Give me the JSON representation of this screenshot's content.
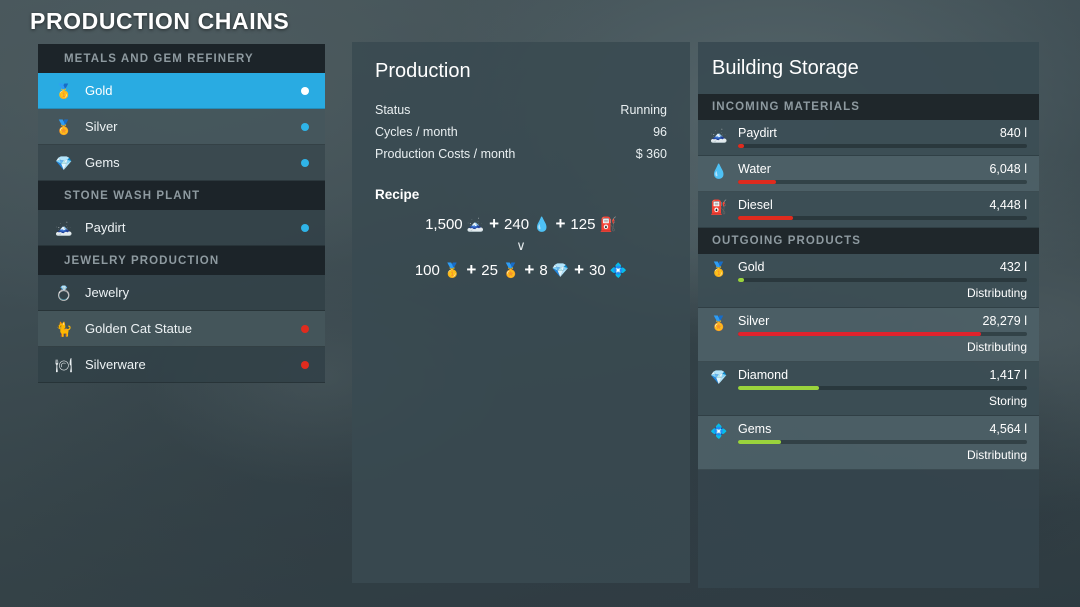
{
  "page": {
    "title": "PRODUCTION CHAINS"
  },
  "sidebar": {
    "groups": [
      {
        "header": "METALS AND GEM REFINERY",
        "items": [
          {
            "label": "Gold",
            "icon": "gold-bars-icon",
            "glyph": "🥇",
            "status": "white",
            "selected": true,
            "shade": "sel"
          },
          {
            "label": "Silver",
            "icon": "silver-bars-icon",
            "glyph": "🏅",
            "status": "cyan",
            "selected": false,
            "shade": "light"
          },
          {
            "label": "Gems",
            "icon": "gems-icon",
            "glyph": "💎",
            "status": "cyan",
            "selected": false,
            "shade": "alt"
          }
        ]
      },
      {
        "header": "STONE WASH PLANT",
        "items": [
          {
            "label": "Paydirt",
            "icon": "paydirt-pile-icon",
            "glyph": "🗻",
            "status": "cyan",
            "selected": false,
            "shade": "base"
          }
        ]
      },
      {
        "header": "JEWELRY PRODUCTION",
        "items": [
          {
            "label": "Jewelry",
            "icon": "ring-icon",
            "glyph": "💍",
            "status": "none",
            "selected": false,
            "shade": "base"
          },
          {
            "label": "Golden Cat Statue",
            "icon": "golden-cat-icon",
            "glyph": "🐈",
            "status": "red",
            "selected": false,
            "shade": "light"
          },
          {
            "label": "Silverware",
            "icon": "silverware-icon",
            "glyph": "🍽",
            "status": "red",
            "selected": false,
            "shade": "base"
          }
        ]
      }
    ]
  },
  "production": {
    "title": "Production",
    "stats": [
      {
        "label": "Status",
        "value": "Running"
      },
      {
        "label": "Cycles / month",
        "value": "96"
      },
      {
        "label": "Production Costs / month",
        "value": "$ 360"
      }
    ],
    "recipe_title": "Recipe",
    "recipe_arrow": "∨",
    "inputs": [
      {
        "amount": "1,500",
        "name": "paydirt",
        "glyph": "🗻"
      },
      {
        "amount": "240",
        "name": "water",
        "glyph": "💧"
      },
      {
        "amount": "125",
        "name": "diesel",
        "glyph": "⛽"
      }
    ],
    "outputs": [
      {
        "amount": "100",
        "name": "gold",
        "glyph": "🥇"
      },
      {
        "amount": "25",
        "name": "silver",
        "glyph": "🏅"
      },
      {
        "amount": "8",
        "name": "diamond",
        "glyph": "💎"
      },
      {
        "amount": "30",
        "name": "gems",
        "glyph": "💠"
      }
    ],
    "plus": "+"
  },
  "storage": {
    "title": "Building Storage",
    "incoming_header": "INCOMING MATERIALS",
    "outgoing_header": "OUTGOING PRODUCTS",
    "incoming": [
      {
        "name": "Paydirt",
        "glyph": "🗻",
        "amount": "840 l",
        "fill": 2,
        "color": "#e02b1e",
        "state": ""
      },
      {
        "name": "Water",
        "glyph": "💧",
        "amount": "6,048 l",
        "fill": 13,
        "color": "#e02b1e",
        "state": ""
      },
      {
        "name": "Diesel",
        "glyph": "⛽",
        "amount": "4,448 l",
        "fill": 19,
        "color": "#e02b1e",
        "state": ""
      }
    ],
    "outgoing": [
      {
        "name": "Gold",
        "glyph": "🥇",
        "amount": "432 l",
        "fill": 2,
        "color": "#9ad33c",
        "state": "Distributing"
      },
      {
        "name": "Silver",
        "glyph": "🏅",
        "amount": "28,279 l",
        "fill": 84,
        "color": "#e0232c",
        "state": "Distributing"
      },
      {
        "name": "Diamond",
        "glyph": "💎",
        "amount": "1,417 l",
        "fill": 28,
        "color": "#9ad33c",
        "state": "Storing"
      },
      {
        "name": "Gems",
        "glyph": "💠",
        "amount": "4,564 l",
        "fill": 15,
        "color": "#9ad33c",
        "state": "Distributing"
      }
    ]
  },
  "colors": {
    "accent": "#29abe2",
    "status_ok": "#2fb4e8",
    "status_alert": "#e02b1e",
    "bar_green": "#9ad33c",
    "bar_red": "#e0232c"
  }
}
